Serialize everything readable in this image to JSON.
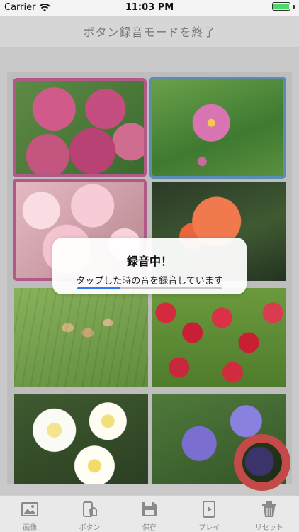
{
  "status_bar": {
    "carrier": "Carrier",
    "time": "11:03 PM"
  },
  "nav": {
    "title": "ボタン録音モードを終了"
  },
  "grid": {
    "tiles": [
      {
        "subject": "hydrangea",
        "selection": "pink"
      },
      {
        "subject": "cosmos",
        "selection": "blue"
      },
      {
        "subject": "cherry-blossom",
        "selection": "pink"
      },
      {
        "subject": "rose",
        "selection": "none"
      },
      {
        "subject": "horsetail",
        "selection": "none"
      },
      {
        "subject": "tulips",
        "selection": "none"
      },
      {
        "subject": "chrysanthemum",
        "selection": "none"
      },
      {
        "subject": "iris",
        "selection": "none"
      }
    ]
  },
  "modal": {
    "title": "録音中！",
    "message": "タップした時の音を録音しています",
    "progress": 0.3
  },
  "record_button": {
    "icon": "record-ring-icon",
    "color": "#c44a4a"
  },
  "tabs": [
    {
      "label": "画像",
      "icon": "image-icon"
    },
    {
      "label": "ボタン",
      "icon": "button-tap-icon"
    },
    {
      "label": "保存",
      "icon": "save-icon"
    },
    {
      "label": "プレイ",
      "icon": "play-icon"
    },
    {
      "label": "リセット",
      "icon": "trash-icon"
    }
  ],
  "colors": {
    "accent_blue": "#3478f6",
    "selection_pink": "#b15a87",
    "selection_blue": "#5b8db4",
    "record_red": "#c44a4a",
    "battery_green": "#4cd964"
  }
}
